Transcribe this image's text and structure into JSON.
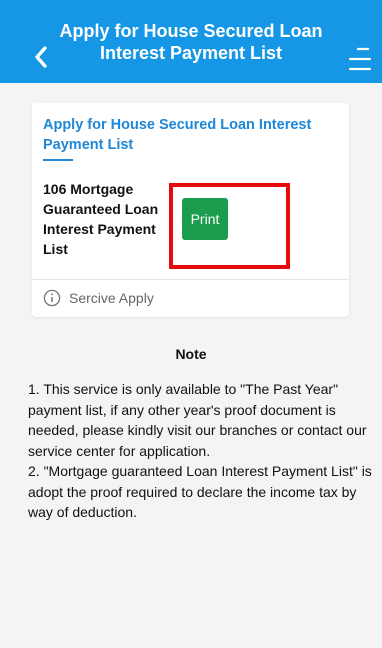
{
  "header": {
    "title": "Apply for House Secured Loan Interest Payment List",
    "back_icon": "chevron-left-icon",
    "menu_icon": "menu-icon",
    "background_color": "#1597e5"
  },
  "card": {
    "title": "Apply for House Secured Loan Interest Payment List",
    "item_name": "106 Mortgage Guaranteed Loan Interest Payment List",
    "print_label": "Print",
    "print_color": "#1a9e4d",
    "highlight_color": "#e50b0b",
    "service_icon": "info-icon",
    "service_label": "Sercive Apply"
  },
  "note": {
    "title": "Note",
    "line1": "1. This service is only available to \"The Past Year\" payment list, if any other year's proof document is needed, please kindly visit our branches or contact our service center for application.",
    "line2": "2. \"Mortgage guaranteed Loan Interest Payment List\" is adopt the proof required to declare the income tax by way of deduction."
  }
}
